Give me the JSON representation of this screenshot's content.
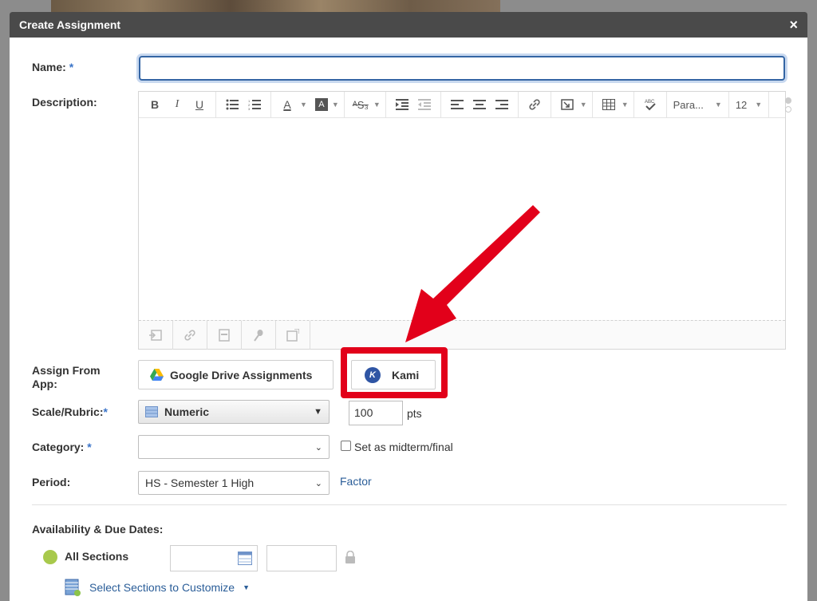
{
  "dialog": {
    "title": "Create Assignment",
    "close_label": "×"
  },
  "form": {
    "name_label": "Name:",
    "required_mark": "*",
    "description_label": "Description:",
    "assign_from_app_label": "Assign From App:",
    "scale_label": "Scale/Rubric:",
    "category_label": "Category:",
    "period_label": "Period:",
    "availability_label": "Availability & Due Dates:"
  },
  "toolbar": {
    "bold": "B",
    "italic": "I",
    "underline": "U",
    "font_color": "A",
    "bg_color": "A",
    "paragraph": "Para...",
    "font_size": "12"
  },
  "apps": {
    "google_drive_label": "Google Drive Assignments",
    "kami_label": "Kami",
    "kami_logo_letter": "K"
  },
  "scale": {
    "selected": "Numeric",
    "points_value": "100",
    "points_unit": "pts"
  },
  "category": {
    "selected": "",
    "midterm_label": "Set as midterm/final"
  },
  "period": {
    "selected": "HS - Semester 1 High",
    "factor_link": "Factor"
  },
  "sections": {
    "all_sections_label": "All Sections",
    "customize_link": "Select Sections to Customize"
  },
  "colors": {
    "header_bg": "#4a4a4a",
    "accent_blue": "#3465a4",
    "highlight_red": "#e2001a",
    "link_blue": "#2a5d98",
    "status_green": "#a8c94c"
  }
}
